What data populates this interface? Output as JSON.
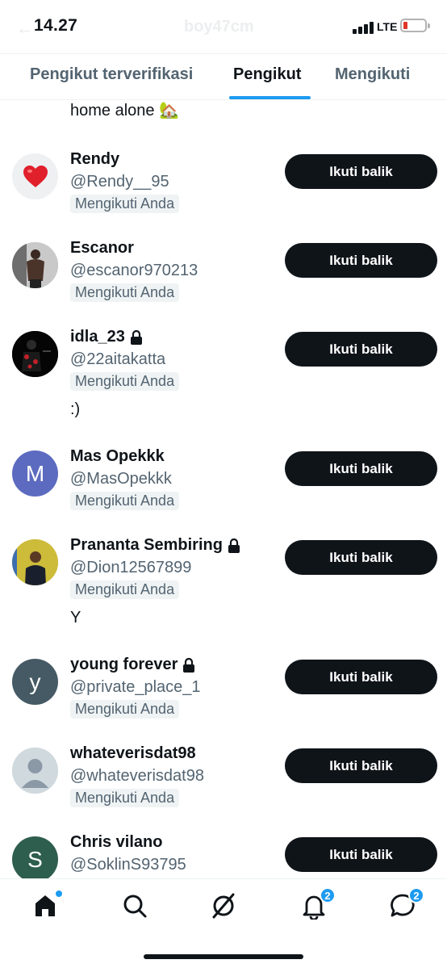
{
  "status_bar": {
    "time": "14.27",
    "network": "LTE",
    "ghost_title": "boy47cm"
  },
  "tabs": [
    {
      "label": "Pengikut terverifikasi"
    },
    {
      "label": "Pengikut"
    },
    {
      "label": "Mengikuti"
    }
  ],
  "previous_bio": "home alone 🏡",
  "followers": [
    {
      "name": "Rendy",
      "handle": "@Rendy__95",
      "badge": "Mengikuti Anda",
      "bio": "",
      "button": "Ikuti balik",
      "locked": false,
      "avatar": "heart"
    },
    {
      "name": "Escanor",
      "handle": "@escanor970213",
      "badge": "Mengikuti Anda",
      "bio": "",
      "button": "Ikuti balik",
      "locked": false,
      "avatar": "photo-gym"
    },
    {
      "name": "idla_23",
      "handle": "@22aitakatta",
      "badge": "Mengikuti Anda",
      "bio": ":)",
      "button": "Ikuti balik",
      "locked": true,
      "avatar": "photo-dark"
    },
    {
      "name": "Mas Opekkk",
      "handle": "@MasOpekkk",
      "badge": "Mengikuti Anda",
      "bio": "",
      "button": "Ikuti balik",
      "locked": false,
      "avatar_letter": "M",
      "avatar_color": "#5c6bc0"
    },
    {
      "name": "Prananta Sembiring",
      "handle": "@Dion12567899",
      "badge": "Mengikuti Anda",
      "bio": "Y",
      "button": "Ikuti balik",
      "locked": true,
      "avatar": "photo-yellow"
    },
    {
      "name": "young forever",
      "handle": "@private_place_1",
      "badge": "Mengikuti Anda",
      "bio": "",
      "button": "Ikuti balik",
      "locked": true,
      "avatar_letter": "y",
      "avatar_color": "#455a64"
    },
    {
      "name": "whateverisdat98",
      "handle": "@whateverisdat98",
      "badge": "Mengikuti Anda",
      "bio": "",
      "button": "Ikuti balik",
      "locked": false,
      "avatar": "default"
    },
    {
      "name": "Chris vilano",
      "handle": "@SoklinS93795",
      "badge": "",
      "bio": "",
      "button": "Ikuti balik",
      "locked": false,
      "avatar_letter": "S",
      "avatar_color": "#2e5e4e"
    }
  ],
  "bottom_nav": {
    "notifications_badge": "2",
    "messages_badge": "2"
  },
  "colors": {
    "accent": "#1d9bf0",
    "text": "#0f1419",
    "secondary": "#536471"
  }
}
